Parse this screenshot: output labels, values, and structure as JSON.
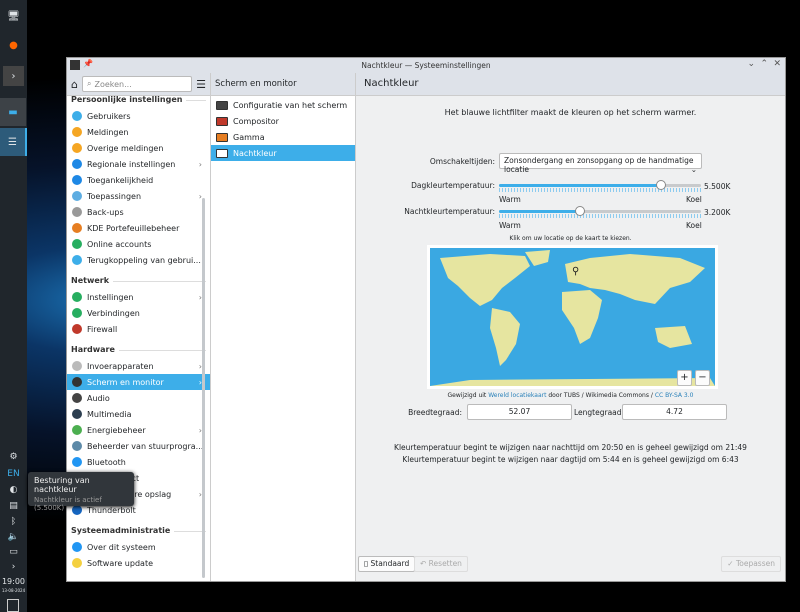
{
  "window": {
    "title": "Nachtkleur — Systeeminstellingen"
  },
  "sidebar": {
    "search_placeholder": "Zoeken...",
    "sections": [
      {
        "title": "Persoonlijke instellingen",
        "items": [
          "Gebruikers",
          "Meldingen",
          "Overige meldingen",
          "Regionale instellingen",
          "Toegankelijkheid",
          "Toepassingen",
          "Back-ups",
          "KDE Portefeuillebeheer",
          "Online accounts",
          "Terugkoppeling van gebrui..."
        ]
      },
      {
        "title": "Netwerk",
        "items": [
          "Instellingen",
          "Verbindingen",
          "Firewall"
        ]
      },
      {
        "title": "Hardware",
        "items": [
          "Invoerapparaten",
          "Scherm en monitor",
          "Audio",
          "Multimedia",
          "Energiebeheer",
          "Beheerder van stuurprogra...",
          "Bluetooth",
          "KDE Connect",
          "Verwijderbare opslag",
          "Thunderbolt"
        ]
      },
      {
        "title": "Systeemadministratie",
        "items": [
          "Over dit systeem",
          "Software update"
        ]
      }
    ]
  },
  "subpanel": {
    "title": "Scherm en monitor",
    "items": [
      "Configuratie van het scherm",
      "Compositor",
      "Gamma",
      "Nachtkleur"
    ]
  },
  "main": {
    "title": "Nachtkleur",
    "intro": "Het blauwe lichtfilter maakt de kleuren op het scherm warmer.",
    "switch_label": "Omschakeltijden:",
    "switch_value": "Zonsondergang en zonsopgang op de handmatige locatie",
    "day_label": "Dagkleurtemperatuur:",
    "day_value": "5.500K",
    "day_fraction": 0.8,
    "night_label": "Nachtkleurtemperatuur:",
    "night_value": "3.200K",
    "night_fraction": 0.4,
    "warm": "Warm",
    "cool": "Koel",
    "map_hint": "Klik om uw locatie op de kaart te kiezen.",
    "credit_pre": "Gewijzigd uit",
    "credit_link1": "Wereld locatiekaart",
    "credit_mid": "door TUBS / Wikimedia Commons /",
    "credit_link2": "CC BY-SA 3.0",
    "lat_label": "Breedtegraad:",
    "lat": "52.07",
    "lon_label": "Lengtegraad:",
    "lon": "4.72",
    "info1": "Kleurtemperatuur begint te wijzigen naar nachttijd om 20:50 en is geheel gewijzigd om 21:49",
    "info2": "Kleurtemperatuur begint te wijzigen naar dagtijd om 5:44 en is geheel gewijzigd om 6:43",
    "zoom_in": "+",
    "zoom_out": "−"
  },
  "footer": {
    "default": "Standaard",
    "reset": "Resetten",
    "apply": "Toepassen"
  },
  "tray": {
    "lang": "EN",
    "time": "19:00",
    "date": "13-08-2024"
  },
  "tooltip": {
    "title": "Besturing van nachtkleur",
    "body": "Nachtkleur is actief (5.500K)"
  },
  "colors": {
    "accent": "#3daee9"
  }
}
